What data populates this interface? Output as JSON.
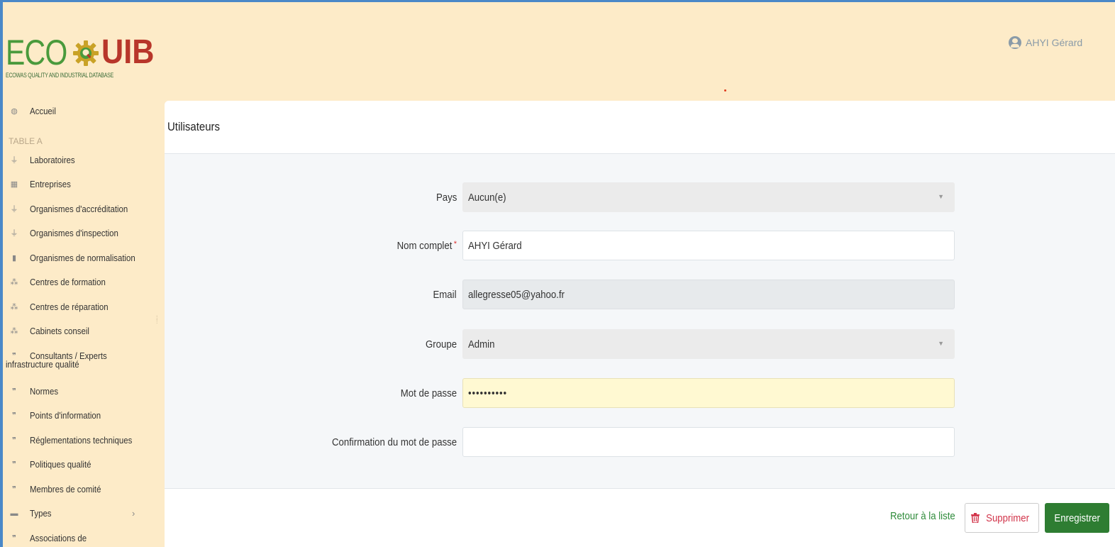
{
  "brand": {
    "logo_eco": "ECO",
    "logo_uib": "UIB",
    "logo_sub": "ECOWAS QUALITY AND INDUSTRIAL DATABASE",
    "color_green": "#4a9a3c",
    "color_red": "#b8362a"
  },
  "header": {
    "user_name": "AHYI Gérard",
    "user_icon": "user-circle-icon"
  },
  "sidebar": {
    "home": {
      "label": "Accueil",
      "icon": "dashboard-icon"
    },
    "section_label": "TABLE A",
    "items": [
      {
        "label": "Laboratoires",
        "icon": "flask-icon"
      },
      {
        "label": "Entreprises",
        "icon": "building-icon"
      },
      {
        "label": "Organismes d'accréditation",
        "icon": "flask-icon"
      },
      {
        "label": "Organismes d'inspection",
        "icon": "flask-icon"
      },
      {
        "label": "Organismes de normalisation",
        "icon": "book-icon"
      },
      {
        "label": "Centres de formation",
        "icon": "sitemap-icon"
      },
      {
        "label": "Centres de réparation",
        "icon": "sitemap-icon"
      },
      {
        "label": "Cabinets conseil",
        "icon": "sitemap-icon"
      },
      {
        "label": "Consultants / Experts",
        "label2": "infrastructure qualité",
        "icon": "quote-icon"
      },
      {
        "label": "Normes",
        "icon": "quote-icon"
      },
      {
        "label": "Points d'information",
        "icon": "quote-icon"
      },
      {
        "label": "Réglementations techniques",
        "icon": "quote-icon"
      },
      {
        "label": "Politiques qualité",
        "icon": "quote-icon"
      },
      {
        "label": "Membres de comité",
        "icon": "quote-icon"
      },
      {
        "label": "Types",
        "icon": "folder-icon"
      },
      {
        "label": "Associations de",
        "icon": "quote-icon"
      }
    ]
  },
  "panel": {
    "title": "Utilisateurs"
  },
  "form": {
    "pays": {
      "label": "Pays",
      "value": "Aucun(e)"
    },
    "nom": {
      "label": "Nom complet",
      "required_mark": "*",
      "value": "AHYI Gérard"
    },
    "email": {
      "label": "Email",
      "value": "allegresse05@yahoo.fr"
    },
    "groupe": {
      "label": "Groupe",
      "value": "Admin"
    },
    "password": {
      "label": "Mot de passe",
      "value": "••••••••••"
    },
    "confirm": {
      "label": "Confirmation du mot de passe",
      "value": ""
    }
  },
  "footer": {
    "back_label": "Retour à la liste",
    "delete_label": "Supprimer",
    "save_label": "Enregistrer",
    "save_color": "#2e7d32",
    "delete_color": "#d2344a"
  }
}
